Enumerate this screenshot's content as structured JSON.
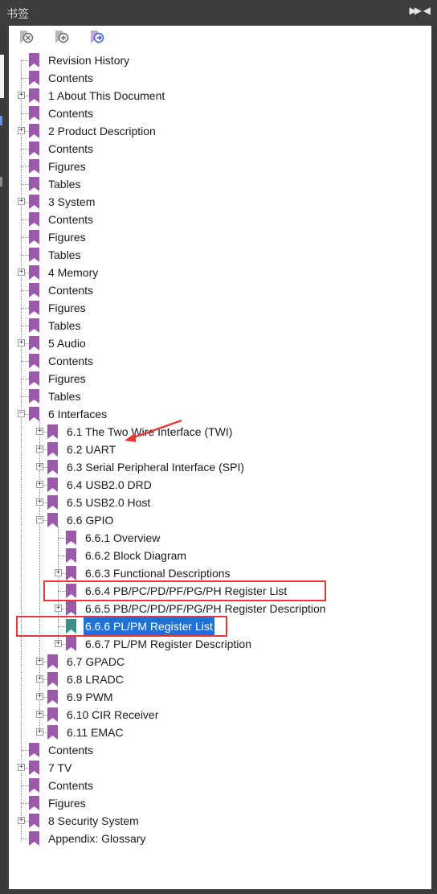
{
  "window": {
    "title": "书签"
  },
  "colors": {
    "bookmark": "#9b5aa8",
    "bookmark_selected": "#3c8f86",
    "selection": "#1e73d2",
    "highlight": "#e53935"
  },
  "toolbar": {
    "buttons": [
      {
        "name": "delete-bookmark-icon"
      },
      {
        "name": "add-bookmark-icon"
      },
      {
        "name": "go-to-bookmark-icon"
      }
    ]
  },
  "bookmarks": [
    {
      "label": "Revision History",
      "level": 0,
      "expander": "none"
    },
    {
      "label": "Contents",
      "level": 0,
      "expander": "none"
    },
    {
      "label": "1 About This Document",
      "level": 0,
      "expander": "plus"
    },
    {
      "label": "Contents",
      "level": 0,
      "expander": "none"
    },
    {
      "label": "2 Product Description",
      "level": 0,
      "expander": "plus"
    },
    {
      "label": "Contents",
      "level": 0,
      "expander": "none"
    },
    {
      "label": "Figures",
      "level": 0,
      "expander": "none"
    },
    {
      "label": "Tables",
      "level": 0,
      "expander": "none"
    },
    {
      "label": "3 System",
      "level": 0,
      "expander": "plus"
    },
    {
      "label": "Contents",
      "level": 0,
      "expander": "none"
    },
    {
      "label": "Figures",
      "level": 0,
      "expander": "none"
    },
    {
      "label": "Tables",
      "level": 0,
      "expander": "none"
    },
    {
      "label": "4 Memory",
      "level": 0,
      "expander": "plus"
    },
    {
      "label": "Contents",
      "level": 0,
      "expander": "none"
    },
    {
      "label": "Figures",
      "level": 0,
      "expander": "none"
    },
    {
      "label": "Tables",
      "level": 0,
      "expander": "none"
    },
    {
      "label": "5 Audio",
      "level": 0,
      "expander": "plus"
    },
    {
      "label": "Contents",
      "level": 0,
      "expander": "none"
    },
    {
      "label": "Figures",
      "level": 0,
      "expander": "none"
    },
    {
      "label": "Tables",
      "level": 0,
      "expander": "none"
    },
    {
      "label": "6 Interfaces",
      "level": 0,
      "expander": "minus"
    },
    {
      "label": "6.1 The Two Wire Interface (TWI)",
      "level": 1,
      "expander": "plus"
    },
    {
      "label": "6.2 UART",
      "level": 1,
      "expander": "plus"
    },
    {
      "label": "6.3 Serial Peripheral Interface (SPI)",
      "level": 1,
      "expander": "plus"
    },
    {
      "label": "6.4 USB2.0 DRD",
      "level": 1,
      "expander": "plus"
    },
    {
      "label": "6.5 USB2.0 Host",
      "level": 1,
      "expander": "plus"
    },
    {
      "label": "6.6 GPIO",
      "level": 1,
      "expander": "minus"
    },
    {
      "label": "6.6.1 Overview",
      "level": 2,
      "expander": "none"
    },
    {
      "label": "6.6.2 Block Diagram",
      "level": 2,
      "expander": "none"
    },
    {
      "label": "6.6.3 Functional Descriptions",
      "level": 2,
      "expander": "plus"
    },
    {
      "label": "6.6.4 PB/PC/PD/PF/PG/PH Register List",
      "level": 2,
      "expander": "none"
    },
    {
      "label": "6.6.5 PB/PC/PD/PF/PG/PH Register Description",
      "level": 2,
      "expander": "plus"
    },
    {
      "label": "6.6.6 PL/PM Register List",
      "level": 2,
      "expander": "none",
      "selected": true
    },
    {
      "label": "6.6.7 PL/PM Register Description",
      "level": 2,
      "expander": "plus"
    },
    {
      "label": "6.7 GPADC",
      "level": 1,
      "expander": "plus"
    },
    {
      "label": "6.8 LRADC",
      "level": 1,
      "expander": "plus"
    },
    {
      "label": "6.9 PWM",
      "level": 1,
      "expander": "plus"
    },
    {
      "label": "6.10 CIR Receiver",
      "level": 1,
      "expander": "plus"
    },
    {
      "label": "6.11 EMAC",
      "level": 1,
      "expander": "plus"
    },
    {
      "label": "Contents",
      "level": 0,
      "expander": "none"
    },
    {
      "label": "7 TV",
      "level": 0,
      "expander": "plus"
    },
    {
      "label": "Contents",
      "level": 0,
      "expander": "none"
    },
    {
      "label": "Figures",
      "level": 0,
      "expander": "none"
    },
    {
      "label": "8 Security System",
      "level": 0,
      "expander": "plus"
    },
    {
      "label": "Appendix: Glossary",
      "level": 0,
      "expander": "none"
    }
  ]
}
